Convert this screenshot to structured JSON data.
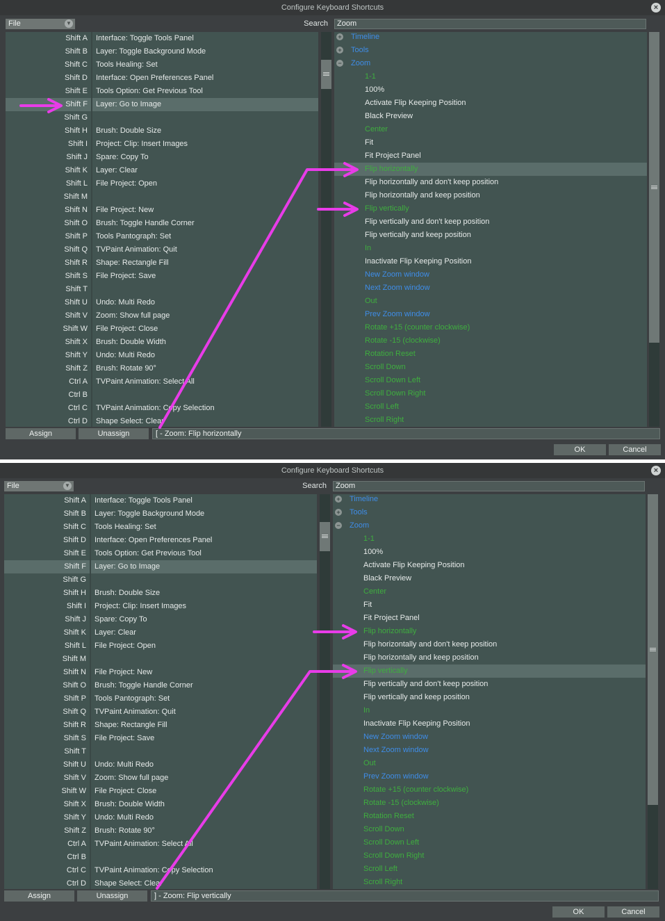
{
  "dialogs": [
    {
      "title": "Configure Keyboard Shortcuts",
      "file_label": "File",
      "search_label": "Search",
      "search_value": "Zoom",
      "assign_label": "Assign",
      "unassign_label": "Unassign",
      "shortcut_value": "[ - Zoom: Flip horizontally",
      "ok_label": "OK",
      "cancel_label": "Cancel"
    },
    {
      "title": "Configure Keyboard Shortcuts",
      "file_label": "File",
      "search_label": "Search",
      "search_value": "Zoom",
      "assign_label": "Assign",
      "unassign_label": "Unassign",
      "shortcut_value": "] - Zoom: Flip vertically",
      "ok_label": "OK",
      "cancel_label": "Cancel"
    }
  ],
  "shortcuts": [
    {
      "key": "Shift A",
      "action": "Interface: Toggle Tools Panel"
    },
    {
      "key": "Shift B",
      "action": "Layer: Toggle Background Mode"
    },
    {
      "key": "Shift C",
      "action": "Tools Healing: Set"
    },
    {
      "key": "Shift D",
      "action": "Interface: Open Preferences Panel"
    },
    {
      "key": "Shift E",
      "action": "Tools Option: Get Previous Tool"
    },
    {
      "key": "Shift F",
      "action": "Layer: Go to Image"
    },
    {
      "key": "Shift G",
      "action": ""
    },
    {
      "key": "Shift H",
      "action": "Brush: Double Size"
    },
    {
      "key": "Shift I",
      "action": "Project: Clip: Insert Images"
    },
    {
      "key": "Shift J",
      "action": "Spare: Copy To"
    },
    {
      "key": "Shift K",
      "action": "Layer: Clear"
    },
    {
      "key": "Shift L",
      "action": "File Project: Open"
    },
    {
      "key": "Shift M",
      "action": ""
    },
    {
      "key": "Shift N",
      "action": "File Project: New"
    },
    {
      "key": "Shift O",
      "action": "Brush: Toggle Handle Corner"
    },
    {
      "key": "Shift P",
      "action": "Tools Pantograph: Set"
    },
    {
      "key": "Shift Q",
      "action": "TVPaint Animation: Quit"
    },
    {
      "key": "Shift R",
      "action": "Shape: Rectangle Fill"
    },
    {
      "key": "Shift S",
      "action": "File Project: Save"
    },
    {
      "key": "Shift T",
      "action": ""
    },
    {
      "key": "Shift U",
      "action": "Undo: Multi Redo"
    },
    {
      "key": "Shift V",
      "action": "Zoom: Show full page"
    },
    {
      "key": "Shift W",
      "action": "File Project: Close"
    },
    {
      "key": "Shift X",
      "action": "Brush: Double Width"
    },
    {
      "key": "Shift Y",
      "action": "Undo: Multi Redo"
    },
    {
      "key": "Shift Z",
      "action": "Brush: Rotate 90°"
    },
    {
      "key": "Ctrl A",
      "action": "TVPaint Animation: Select All"
    },
    {
      "key": "Ctrl B",
      "action": ""
    },
    {
      "key": "Ctrl C",
      "action": "TVPaint Animation: Copy Selection"
    },
    {
      "key": "Ctrl D",
      "action": "Shape Select: Clear"
    }
  ],
  "tree": [
    {
      "label": "Timeline",
      "color": "blue",
      "toggle": "+",
      "level": 0
    },
    {
      "label": "Tools",
      "color": "blue",
      "toggle": "+",
      "level": 0
    },
    {
      "label": "Zoom",
      "color": "blue",
      "toggle": "-",
      "level": 0
    },
    {
      "label": "1-1",
      "color": "green",
      "level": 1
    },
    {
      "label": "100%",
      "color": "white",
      "level": 1
    },
    {
      "label": "Activate Flip Keeping Position",
      "color": "white",
      "level": 1
    },
    {
      "label": "Black Preview",
      "color": "white",
      "level": 1
    },
    {
      "label": "Center",
      "color": "green",
      "level": 1
    },
    {
      "label": "Fit",
      "color": "white",
      "level": 1
    },
    {
      "label": "Fit Project Panel",
      "color": "white",
      "level": 1
    },
    {
      "label": "Flip horizontally",
      "color": "green",
      "level": 1
    },
    {
      "label": "Flip horizontally and don't keep position",
      "color": "white",
      "level": 1
    },
    {
      "label": "Flip horizontally and keep position",
      "color": "white",
      "level": 1
    },
    {
      "label": "Flip vertically",
      "color": "green",
      "level": 1
    },
    {
      "label": "Flip vertically and don't keep position",
      "color": "white",
      "level": 1
    },
    {
      "label": "Flip vertically and keep position",
      "color": "white",
      "level": 1
    },
    {
      "label": "In",
      "color": "green",
      "level": 1
    },
    {
      "label": "Inactivate Flip Keeping Position",
      "color": "white",
      "level": 1
    },
    {
      "label": "New Zoom window",
      "color": "blue",
      "level": 1
    },
    {
      "label": "Next Zoom window",
      "color": "blue",
      "level": 1
    },
    {
      "label": "Out",
      "color": "green",
      "level": 1
    },
    {
      "label": "Prev Zoom window",
      "color": "blue",
      "level": 1
    },
    {
      "label": "Rotate +15 (counter clockwise)",
      "color": "green",
      "level": 1
    },
    {
      "label": "Rotate -15 (clockwise)",
      "color": "green",
      "level": 1
    },
    {
      "label": "Rotation Reset",
      "color": "green",
      "level": 1
    },
    {
      "label": "Scroll Down",
      "color": "green",
      "level": 1
    },
    {
      "label": "Scroll Down Left",
      "color": "green",
      "level": 1
    },
    {
      "label": "Scroll Down Right",
      "color": "green",
      "level": 1
    },
    {
      "label": "Scroll Left",
      "color": "green",
      "level": 1
    },
    {
      "label": "Scroll Right",
      "color": "green",
      "level": 1
    }
  ],
  "state": [
    {
      "left_selected": 5,
      "right_selected": 10
    },
    {
      "left_selected": 5,
      "right_selected": 13
    }
  ],
  "colors": {
    "panel": "#425451",
    "selected_row": "#5a6d6a",
    "annotation": "#e83ce8",
    "item_blue": "#3f8de8",
    "item_green": "#3fae3f"
  },
  "icons": {
    "close": "close-icon",
    "dropdown": "chevron-down-icon",
    "expand": "plus-circle-icon",
    "collapse": "minus-circle-icon",
    "grip": "grip-icon",
    "arrow": "arrow-icon"
  }
}
